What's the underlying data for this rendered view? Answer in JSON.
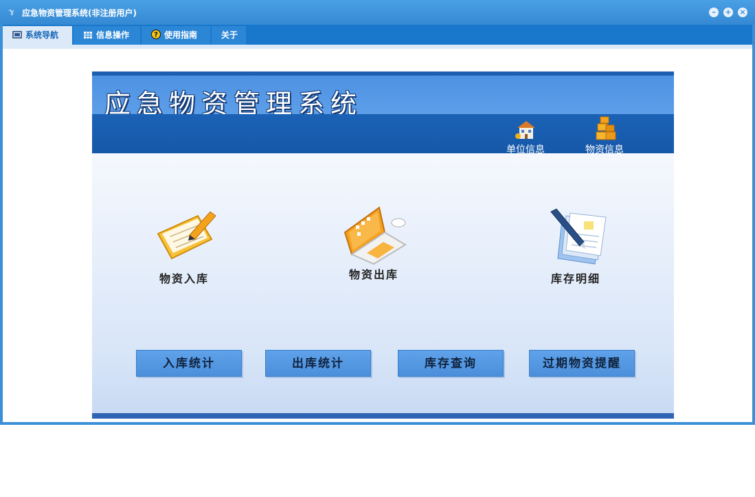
{
  "window": {
    "title": "应急物资管理系统(非注册用户)",
    "logo_glyph": "ℽ"
  },
  "tabs": [
    {
      "label": "系统导航",
      "icon": "monitor-icon",
      "active": true
    },
    {
      "label": "信息操作",
      "icon": "grid-icon",
      "active": false
    },
    {
      "label": "使用指南",
      "icon": "help-icon",
      "active": false
    },
    {
      "label": "关于",
      "icon": "",
      "active": false
    }
  ],
  "panel": {
    "title": "应急物资管理系统",
    "header_items": [
      {
        "label": "单位信息",
        "icon": "building-icon"
      },
      {
        "label": "物资信息",
        "icon": "boxes-icon"
      }
    ],
    "features": [
      {
        "label": "物资入库",
        "icon": "notebook-pencil-icon"
      },
      {
        "label": "物资出库",
        "icon": "laptop-icon"
      },
      {
        "label": "库存明细",
        "icon": "document-pen-icon"
      }
    ],
    "buttons": [
      {
        "label": "入库统计"
      },
      {
        "label": "出库统计"
      },
      {
        "label": "库存查询"
      },
      {
        "label": "过期物资提醒"
      }
    ]
  },
  "colors": {
    "accent": "#3a8fd6",
    "tabbar": "#1a78cc",
    "header_dark": "#1658a8",
    "header_light": "#5d9ee8",
    "button": "#4b8fdb"
  }
}
